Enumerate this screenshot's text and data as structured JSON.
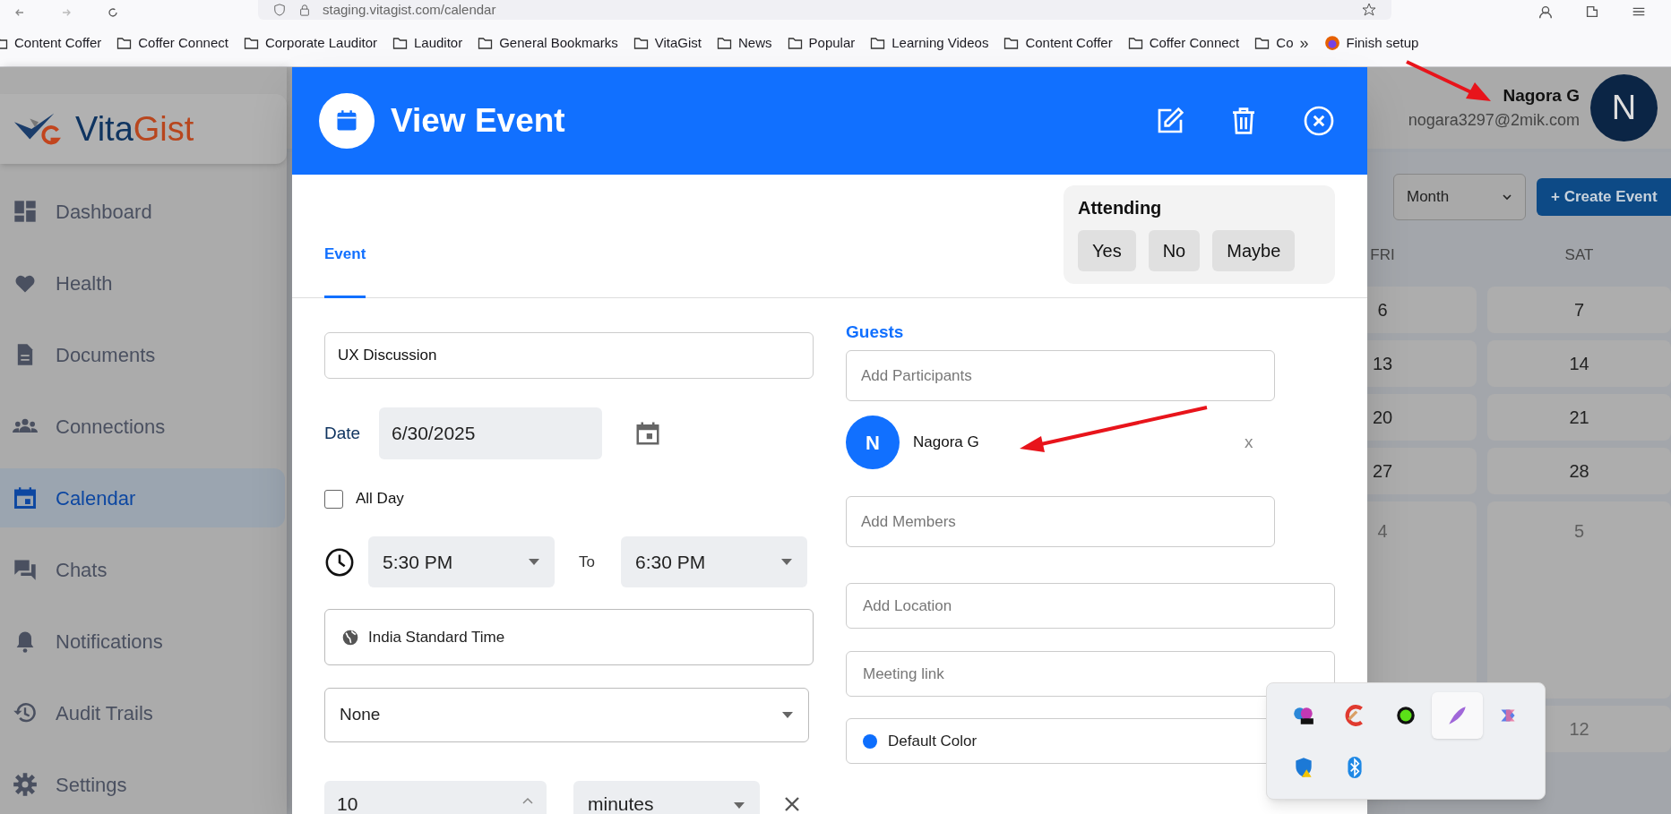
{
  "browser": {
    "url": "staging.vitagist.com/calendar",
    "bookmarks": [
      "Content Coffer",
      "Coffer Connect",
      "Corporate Lauditor",
      "Lauditor",
      "General Bookmarks",
      "VitaGist",
      "News",
      "Popular",
      "Learning Videos",
      "Content Coffer",
      "Coffer Connect",
      "Co"
    ],
    "more": "»",
    "setup": "Finish setup"
  },
  "sidebar": {
    "logo": {
      "part_1": "Vita",
      "part_2": "Gist"
    },
    "items": [
      {
        "label": "Dashboard",
        "selected": false
      },
      {
        "label": "Health",
        "selected": false
      },
      {
        "label": "Documents",
        "selected": false
      },
      {
        "label": "Connections",
        "selected": false
      },
      {
        "label": "Calendar",
        "selected": true
      },
      {
        "label": "Chats",
        "selected": false
      },
      {
        "label": "Notifications",
        "selected": false
      },
      {
        "label": "Audit Trails",
        "selected": false
      },
      {
        "label": "Settings",
        "selected": false
      }
    ]
  },
  "user": {
    "name": "Nagora G",
    "email": "nogara3297@2mik.com",
    "initial": "N"
  },
  "toolbar": {
    "view": "Month",
    "create_button": "+ Create Event"
  },
  "calendar": {
    "columns": [
      {
        "heading": "FRI",
        "days": [
          {
            "day": "6",
            "muted": false
          },
          {
            "day": "13",
            "muted": false
          },
          {
            "day": "20",
            "muted": false
          },
          {
            "day": "27",
            "muted": false
          },
          {
            "day": "4",
            "muted": true
          }
        ]
      },
      {
        "heading": "SAT",
        "days": [
          {
            "day": "7",
            "muted": false
          },
          {
            "day": "14",
            "muted": false
          },
          {
            "day": "21",
            "muted": false
          },
          {
            "day": "28",
            "muted": false
          },
          {
            "day": "5",
            "muted": true
          },
          {
            "day": "12",
            "muted": true
          }
        ]
      }
    ]
  },
  "modal": {
    "title": "View Event",
    "tabs": [
      {
        "label": "Event",
        "selected": true
      }
    ],
    "attending": {
      "title": "Attending",
      "options": [
        {
          "label": "Yes",
          "selected": false
        },
        {
          "label": "No",
          "selected": false
        },
        {
          "label": "Maybe",
          "selected": false
        }
      ]
    },
    "form": {
      "title_value": "UX Discussion",
      "date_label": "Date",
      "date_value": "6/30/2025",
      "all_day": {
        "label": "All Day",
        "checked": false
      },
      "start_time": "5:30 PM",
      "to_label": "To",
      "end_time": "6:30 PM",
      "timezone": "India Standard Time",
      "repeat": "None",
      "reminder_value": "10",
      "reminder_unit": "minutes"
    },
    "guests": {
      "title": "Guests",
      "participants_placeholder": "Add Participants",
      "list": [
        {
          "initial": "N",
          "name": "Nagora G",
          "remove": "x"
        }
      ],
      "members_placeholder": "Add Members"
    },
    "location_placeholder": "Add Location",
    "meeting_link_placeholder": "Meeting link",
    "event_color": {
      "label": "Default Color",
      "color": "#0d6efd"
    }
  }
}
